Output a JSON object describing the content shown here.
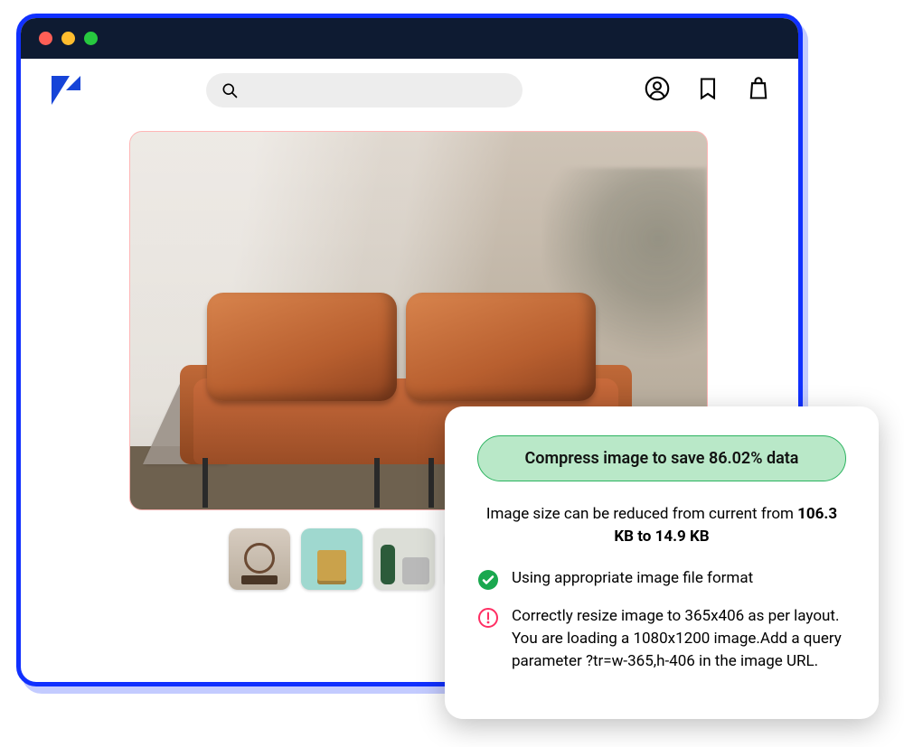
{
  "analysis": {
    "pill_label": "Compress image to save 86.02% data",
    "reduction_prefix": "Image size can be reduced from current from ",
    "reduction_strong": "106.3 KB to 14.9 KB",
    "ok_text": "Using appropriate image file format",
    "warn_text": "Correctly resize image to 365x406 as per layout. You are loading a 1080x1200 image.Add a query parameter ?tr=w-365,h-406 in the image URL."
  }
}
